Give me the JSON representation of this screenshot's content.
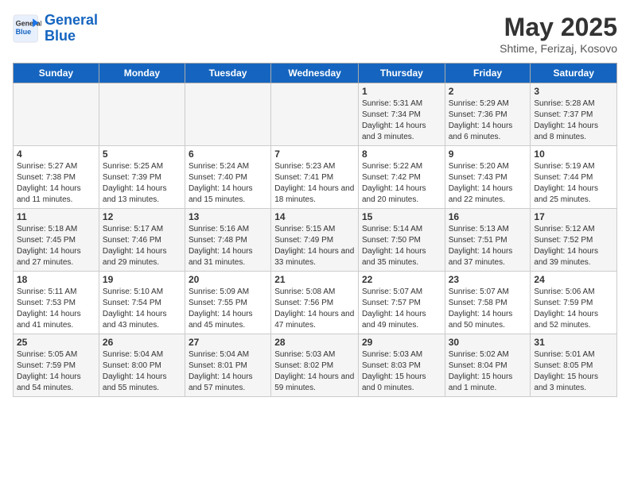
{
  "header": {
    "logo_line1": "General",
    "logo_line2": "Blue",
    "title": "May 2025",
    "subtitle": "Shtime, Ferizaj, Kosovo"
  },
  "weekdays": [
    "Sunday",
    "Monday",
    "Tuesday",
    "Wednesday",
    "Thursday",
    "Friday",
    "Saturday"
  ],
  "weeks": [
    [
      {
        "day": "",
        "info": ""
      },
      {
        "day": "",
        "info": ""
      },
      {
        "day": "",
        "info": ""
      },
      {
        "day": "",
        "info": ""
      },
      {
        "day": "1",
        "info": "Sunrise: 5:31 AM\nSunset: 7:34 PM\nDaylight: 14 hours\nand 3 minutes."
      },
      {
        "day": "2",
        "info": "Sunrise: 5:29 AM\nSunset: 7:36 PM\nDaylight: 14 hours\nand 6 minutes."
      },
      {
        "day": "3",
        "info": "Sunrise: 5:28 AM\nSunset: 7:37 PM\nDaylight: 14 hours\nand 8 minutes."
      }
    ],
    [
      {
        "day": "4",
        "info": "Sunrise: 5:27 AM\nSunset: 7:38 PM\nDaylight: 14 hours\nand 11 minutes."
      },
      {
        "day": "5",
        "info": "Sunrise: 5:25 AM\nSunset: 7:39 PM\nDaylight: 14 hours\nand 13 minutes."
      },
      {
        "day": "6",
        "info": "Sunrise: 5:24 AM\nSunset: 7:40 PM\nDaylight: 14 hours\nand 15 minutes."
      },
      {
        "day": "7",
        "info": "Sunrise: 5:23 AM\nSunset: 7:41 PM\nDaylight: 14 hours\nand 18 minutes."
      },
      {
        "day": "8",
        "info": "Sunrise: 5:22 AM\nSunset: 7:42 PM\nDaylight: 14 hours\nand 20 minutes."
      },
      {
        "day": "9",
        "info": "Sunrise: 5:20 AM\nSunset: 7:43 PM\nDaylight: 14 hours\nand 22 minutes."
      },
      {
        "day": "10",
        "info": "Sunrise: 5:19 AM\nSunset: 7:44 PM\nDaylight: 14 hours\nand 25 minutes."
      }
    ],
    [
      {
        "day": "11",
        "info": "Sunrise: 5:18 AM\nSunset: 7:45 PM\nDaylight: 14 hours\nand 27 minutes."
      },
      {
        "day": "12",
        "info": "Sunrise: 5:17 AM\nSunset: 7:46 PM\nDaylight: 14 hours\nand 29 minutes."
      },
      {
        "day": "13",
        "info": "Sunrise: 5:16 AM\nSunset: 7:48 PM\nDaylight: 14 hours\nand 31 minutes."
      },
      {
        "day": "14",
        "info": "Sunrise: 5:15 AM\nSunset: 7:49 PM\nDaylight: 14 hours\nand 33 minutes."
      },
      {
        "day": "15",
        "info": "Sunrise: 5:14 AM\nSunset: 7:50 PM\nDaylight: 14 hours\nand 35 minutes."
      },
      {
        "day": "16",
        "info": "Sunrise: 5:13 AM\nSunset: 7:51 PM\nDaylight: 14 hours\nand 37 minutes."
      },
      {
        "day": "17",
        "info": "Sunrise: 5:12 AM\nSunset: 7:52 PM\nDaylight: 14 hours\nand 39 minutes."
      }
    ],
    [
      {
        "day": "18",
        "info": "Sunrise: 5:11 AM\nSunset: 7:53 PM\nDaylight: 14 hours\nand 41 minutes."
      },
      {
        "day": "19",
        "info": "Sunrise: 5:10 AM\nSunset: 7:54 PM\nDaylight: 14 hours\nand 43 minutes."
      },
      {
        "day": "20",
        "info": "Sunrise: 5:09 AM\nSunset: 7:55 PM\nDaylight: 14 hours\nand 45 minutes."
      },
      {
        "day": "21",
        "info": "Sunrise: 5:08 AM\nSunset: 7:56 PM\nDaylight: 14 hours\nand 47 minutes."
      },
      {
        "day": "22",
        "info": "Sunrise: 5:07 AM\nSunset: 7:57 PM\nDaylight: 14 hours\nand 49 minutes."
      },
      {
        "day": "23",
        "info": "Sunrise: 5:07 AM\nSunset: 7:58 PM\nDaylight: 14 hours\nand 50 minutes."
      },
      {
        "day": "24",
        "info": "Sunrise: 5:06 AM\nSunset: 7:59 PM\nDaylight: 14 hours\nand 52 minutes."
      }
    ],
    [
      {
        "day": "25",
        "info": "Sunrise: 5:05 AM\nSunset: 7:59 PM\nDaylight: 14 hours\nand 54 minutes."
      },
      {
        "day": "26",
        "info": "Sunrise: 5:04 AM\nSunset: 8:00 PM\nDaylight: 14 hours\nand 55 minutes."
      },
      {
        "day": "27",
        "info": "Sunrise: 5:04 AM\nSunset: 8:01 PM\nDaylight: 14 hours\nand 57 minutes."
      },
      {
        "day": "28",
        "info": "Sunrise: 5:03 AM\nSunset: 8:02 PM\nDaylight: 14 hours\nand 59 minutes."
      },
      {
        "day": "29",
        "info": "Sunrise: 5:03 AM\nSunset: 8:03 PM\nDaylight: 15 hours\nand 0 minutes."
      },
      {
        "day": "30",
        "info": "Sunrise: 5:02 AM\nSunset: 8:04 PM\nDaylight: 15 hours\nand 1 minute."
      },
      {
        "day": "31",
        "info": "Sunrise: 5:01 AM\nSunset: 8:05 PM\nDaylight: 15 hours\nand 3 minutes."
      }
    ]
  ]
}
